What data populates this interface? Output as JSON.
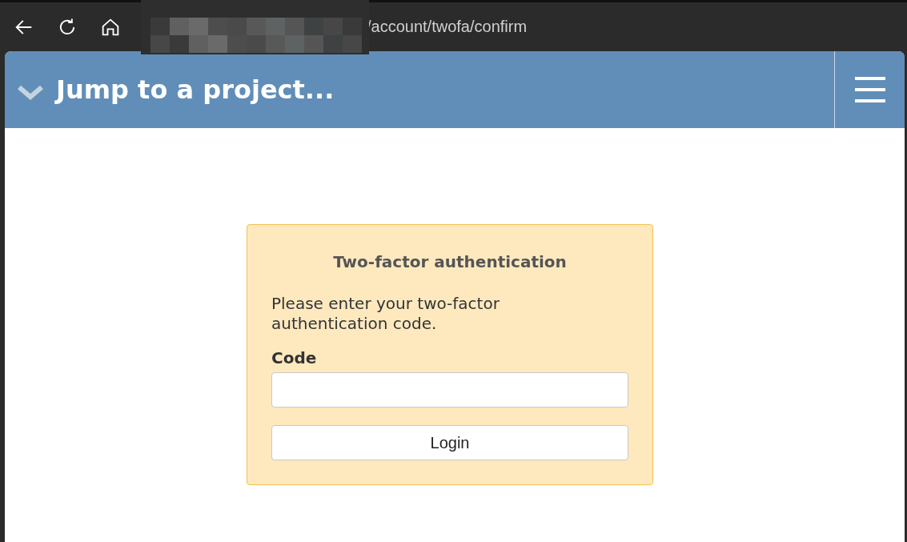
{
  "browser": {
    "url": "/account/twofa/confirm"
  },
  "header": {
    "title": "Jump to a project..."
  },
  "card": {
    "title": "Two-factor authentication",
    "message": "Please enter your two-factor authentication code.",
    "field_label": "Code",
    "button": "Login"
  }
}
